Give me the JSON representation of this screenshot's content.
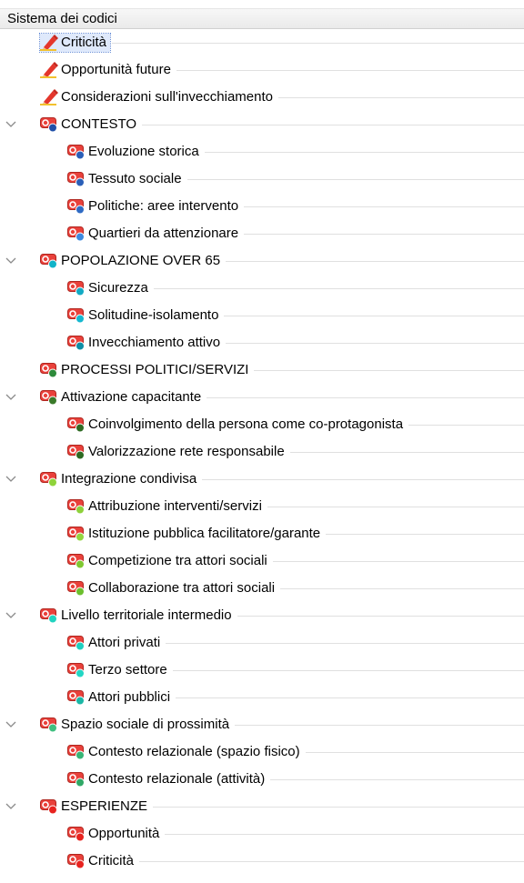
{
  "header": {
    "title": "Sistema dei codici"
  },
  "tree": [
    {
      "label": "Criticità",
      "type": "memo",
      "level": 1,
      "selected": true,
      "name": "criticita-memo"
    },
    {
      "label": "Opportunità future",
      "type": "memo",
      "level": 1,
      "name": "opportunita-future-memo"
    },
    {
      "label": "Considerazioni sull'invecchiamento",
      "type": "memo",
      "level": 1,
      "name": "considerazioni-memo"
    },
    {
      "label": "CONTESTO",
      "type": "code",
      "level": 1,
      "expanded": true,
      "color": "#1f4fa8",
      "name": "contesto"
    },
    {
      "label": "Evoluzione storica",
      "type": "code",
      "level": 2,
      "color": "#2a5fb8",
      "name": "evoluzione-storica"
    },
    {
      "label": "Tessuto sociale",
      "type": "code",
      "level": 2,
      "color": "#2a5fb8",
      "name": "tessuto-sociale"
    },
    {
      "label": "Politiche: aree intervento",
      "type": "code",
      "level": 2,
      "color": "#2f6bc4",
      "name": "politiche-aree-intervento"
    },
    {
      "label": "Quartieri da attenzionare",
      "type": "code",
      "level": 2,
      "color": "#3d8ae0",
      "name": "quartieri-da-attenzionare"
    },
    {
      "label": "POPOLAZIONE OVER 65",
      "type": "code",
      "level": 1,
      "expanded": true,
      "color": "#11b3c8",
      "name": "popolazione-over-65"
    },
    {
      "label": "Sicurezza",
      "type": "code",
      "level": 2,
      "color": "#12aac4",
      "name": "sicurezza"
    },
    {
      "label": "Solitudine-isolamento",
      "type": "code",
      "level": 2,
      "color": "#15b8d0",
      "name": "solitudine-isolamento"
    },
    {
      "label": "Invecchiamento attivo",
      "type": "code",
      "level": 2,
      "color": "#0e8ea6",
      "name": "invecchiamento-attivo"
    },
    {
      "label": "PROCESSI POLITICI/SERVIZI",
      "type": "code",
      "level": 1,
      "color": "#2d8a3a",
      "name": "processi-politici-servizi"
    },
    {
      "label": "Attivazione capacitante",
      "type": "code",
      "level": 1,
      "expanded": true,
      "color": "#3a7a2a",
      "name": "attivazione-capacitante"
    },
    {
      "label": "Coinvolgimento della persona come co-protagonista",
      "type": "code",
      "level": 2,
      "color": "#2f6b24",
      "name": "coinvolgimento-persona"
    },
    {
      "label": "Valorizzazione rete responsabile",
      "type": "code",
      "level": 2,
      "color": "#2c6a22",
      "name": "valorizzazione-rete"
    },
    {
      "label": "Integrazione condivisa",
      "type": "code",
      "level": 1,
      "expanded": true,
      "color": "#8fd33a",
      "name": "integrazione-condivisa"
    },
    {
      "label": "Attribuzione interventi/servizi",
      "type": "code",
      "level": 2,
      "color": "#8ed13b",
      "name": "attribuzione-interventi"
    },
    {
      "label": "Istituzione pubblica facilitatore/garante",
      "type": "code",
      "level": 2,
      "color": "#93d640",
      "name": "istituzione-pubblica"
    },
    {
      "label": "Competizione tra attori sociali",
      "type": "code",
      "level": 2,
      "color": "#7fc832",
      "name": "competizione-attori"
    },
    {
      "label": "Collaborazione tra attori sociali",
      "type": "code",
      "level": 2,
      "color": "#6cbf2e",
      "name": "collaborazione-attori"
    },
    {
      "label": "Livello territoriale intermedio",
      "type": "code",
      "level": 1,
      "expanded": true,
      "color": "#20d3c0",
      "name": "livello-territoriale"
    },
    {
      "label": "Attori privati",
      "type": "code",
      "level": 2,
      "color": "#1fcfc0",
      "name": "attori-privati"
    },
    {
      "label": "Terzo settore",
      "type": "code",
      "level": 2,
      "color": "#22d6c4",
      "name": "terzo-settore"
    },
    {
      "label": "Attori pubblici",
      "type": "code",
      "level": 2,
      "color": "#1bb7a6",
      "name": "attori-pubblici"
    },
    {
      "label": "Spazio sociale di prossimità",
      "type": "code",
      "level": 1,
      "expanded": true,
      "color": "#3fbf7f",
      "name": "spazio-sociale"
    },
    {
      "label": "Contesto relazionale (spazio fisico)",
      "type": "code",
      "level": 2,
      "color": "#37b576",
      "name": "contesto-relazionale-fisico"
    },
    {
      "label": "Contesto relazionale (attività)",
      "type": "code",
      "level": 2,
      "color": "#2fa866",
      "name": "contesto-relazionale-attivita"
    },
    {
      "label": "ESPERIENZE",
      "type": "code",
      "level": 1,
      "expanded": true,
      "color": "#e8231f",
      "name": "esperienze"
    },
    {
      "label": "Opportunità",
      "type": "code",
      "level": 2,
      "color": "#e8231f",
      "name": "opportunita"
    },
    {
      "label": "Criticità",
      "type": "code",
      "level": 2,
      "color": "#e8231f",
      "name": "criticita"
    }
  ]
}
